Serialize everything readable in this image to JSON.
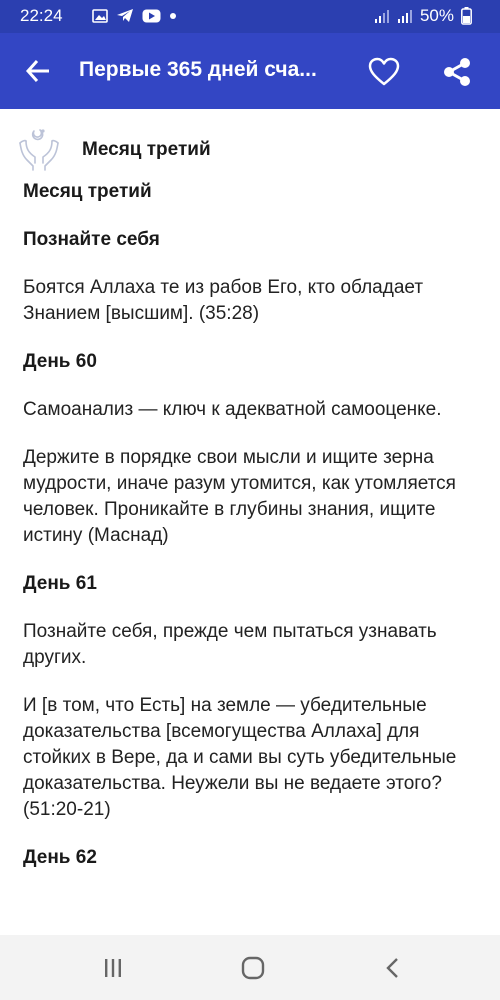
{
  "status_bar": {
    "time": "22:24",
    "battery": "50%",
    "icons": [
      "image-icon",
      "telegram-icon",
      "youtube-icon",
      "dot-icon"
    ]
  },
  "app_bar": {
    "title": "Первые 365 дней сча...",
    "color": "#3346c4"
  },
  "chapter": {
    "header_title": "Месяц третий"
  },
  "article": {
    "title": "Месяц третий",
    "subtitle": "Познайте себя",
    "quote1": "Боятся Аллаха те из рабов Его, кто обладает Знанием [высшим]. (35:28)",
    "day60_title": "День 60",
    "day60_p1": "Самоанализ — ключ к адекватной самооценке.",
    "day60_p2": "Держите в порядке свои мысли и ищите зерна мудрости, иначе разум утомится, как утомляется человек. Проникайте в глубины знания, ищите истину (Маснад)",
    "day61_title": "День 61",
    "day61_p1": "Познайте себя, прежде чем пытаться узнавать других.",
    "day61_p2": "И [в том, что Есть] на земле — убедительные доказательства [всемогущества Аллаха] для стойких в Вере, да и сами вы суть убедительные доказательства. Неужели вы не ведаете этого? (51:20-21)",
    "day62_title": "День 62"
  },
  "nav_bar": {
    "icons": [
      "recents-icon",
      "home-icon",
      "back-nav-icon"
    ]
  }
}
